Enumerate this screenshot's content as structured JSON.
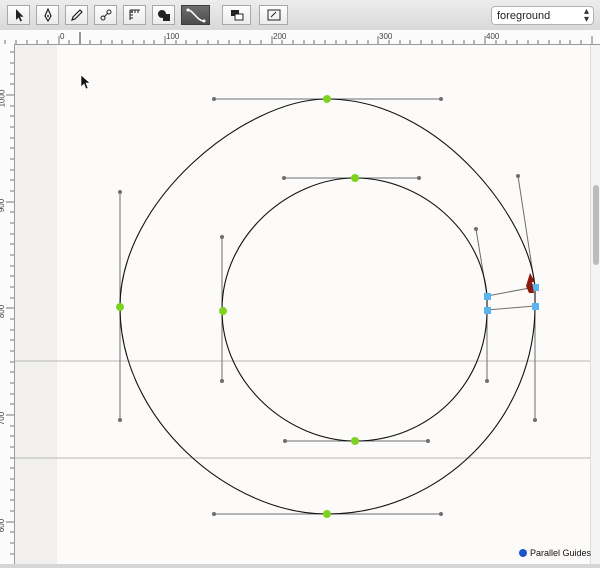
{
  "window": {
    "title": ""
  },
  "toolbar": {
    "tools": [
      {
        "name": "selection-tool",
        "active": false
      },
      {
        "name": "pen-tool",
        "active": false
      },
      {
        "name": "pencil-tool",
        "active": false
      },
      {
        "name": "node-edit-tool",
        "active": false
      },
      {
        "name": "ruler-tool",
        "active": false
      },
      {
        "name": "shape-tool",
        "active": false
      },
      {
        "name": "curve-tool",
        "active": true
      }
    ],
    "layer_select": {
      "value": "foreground"
    }
  },
  "ruler": {
    "horizontal_labels": [
      "0",
      "100",
      "200",
      "300",
      "400"
    ],
    "vertical_labels": [
      "1000",
      "900",
      "800",
      "700",
      "600"
    ]
  },
  "guides": {
    "label": "Parallel Guides"
  },
  "colors": {
    "node_green": "#7ed321",
    "node_blue": "#5ab4f0",
    "handle_gray": "#6e6e6e",
    "outline": "#111111",
    "guide_line": "#b7b7b7",
    "cursor_red": "#8b1a0d"
  }
}
